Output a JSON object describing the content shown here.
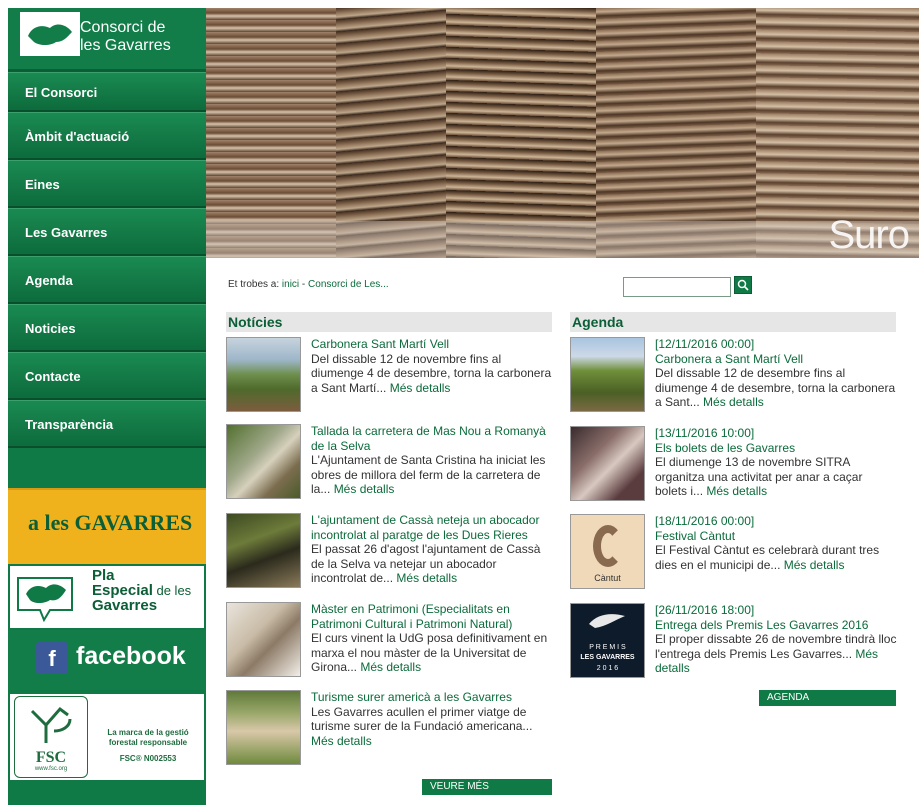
{
  "sidebar": {
    "logo_title_line1": "Consorci de",
    "logo_title_line2": "les Gavarres",
    "items": [
      {
        "label": "El Consorci"
      },
      {
        "label": "Àmbit d'actuació"
      },
      {
        "label": "Eines"
      },
      {
        "label": "Les Gavarres"
      },
      {
        "label": "Agenda"
      },
      {
        "label": "Noticies"
      },
      {
        "label": "Contacte"
      },
      {
        "label": "Transparència"
      }
    ],
    "banner_gavarres": "a les GAVARRES",
    "banner_pla": {
      "line1": "Pla",
      "line2a": "Especial",
      "line2b": " de les",
      "line3": "Gavarres"
    },
    "banner_facebook": {
      "glyph": "f",
      "label": "facebook"
    },
    "banner_fsc": {
      "logo": "FSC",
      "url": "www.fsc.org",
      "tagline": "La marca de la gestió forestal responsable",
      "code": "FSC® N002553"
    }
  },
  "hero": {
    "label": "Suro"
  },
  "breadcrumb": {
    "prefix": "Et trobes a:",
    "home": "inici",
    "separator": " - ",
    "current": "Consorci de Les..."
  },
  "search": {
    "placeholder": "",
    "button_icon": "search-icon"
  },
  "news": {
    "heading": "Notícies",
    "items": [
      {
        "title": "Carbonera Sant Martí Vell",
        "body": "Del dissable 12 de novembre fins al diumenge 4 de desembre, torna la carbonera a Sant Martí...",
        "more": "Més detalls"
      },
      {
        "title": "Tallada la carretera de Mas Nou a Romanyà de la Selva",
        "body": "L'Ajuntament de Santa Cristina ha iniciat les obres de millora del ferm de la carretera de la...",
        "more": "Més detalls"
      },
      {
        "title": "L'ajuntament de Cassà neteja un abocador incontrolat al paratge de les Dues Rieres",
        "body": "El passat 26 d'agost l'ajuntament de Cassà de la Selva va netejar un abocador incontrolat de...",
        "more": "Més detalls"
      },
      {
        "title": "Màster en Patrimoni (Especialitats en Patrimoni Cultural i Patrimoni Natural)",
        "body": "El curs vinent la UdG posa definitivament en marxa el nou màster de la Universitat de Girona...",
        "more": "Més detalls"
      },
      {
        "title": "Turisme surer americà a les Gavarres",
        "body": "  Les Gavarres acullen el primer viatge de turisme surer de la Fundació americana...",
        "more": "Més detalls"
      }
    ],
    "more_button": "VEURE MÉS NOTÍCIES",
    "arrow": "→"
  },
  "agenda": {
    "heading": "Agenda",
    "items": [
      {
        "date": "[12/11/2016 00:00]",
        "title": "Carbonera a Sant Martí Vell",
        "body": "Del dissable 12 de desembre fins al diumenge 4 de desembre, torna la carbonera a Sant...",
        "more": "Més detalls"
      },
      {
        "date": "[13/11/2016 10:00]",
        "title": "Els bolets de les Gavarres",
        "body": "El diumenge 13 de novembre SITRA organitza una activitat per anar a caçar bolets i...",
        "more": "Més detalls"
      },
      {
        "date": "[18/11/2016 00:00]",
        "title": "Festival Càntut",
        "body": "El Festival Càntut es celebrarà durant tres dies en el municipi de...",
        "more": "Més detalls"
      },
      {
        "date": "[26/11/2016 18:00]",
        "title": "Entrega dels Premis Les Gavarres 2016",
        "body": "El proper dissabte 26 de novembre tindrà lloc l'entrega dels Premis Les Gavarres...",
        "more": "Més detalls"
      }
    ],
    "more_button": "AGENDA D'ACTIVITATS",
    "arrow": "→",
    "thumb_labels": {
      "cantut": "Càntut",
      "premis1": "P R E M I S",
      "premis2": "LES GAVARRES",
      "premis3": "2 0 1 6"
    }
  },
  "colors": {
    "brand_green": "#0f7a45",
    "link_green": "#0b6b3a",
    "yellow": "#f0b21c"
  }
}
